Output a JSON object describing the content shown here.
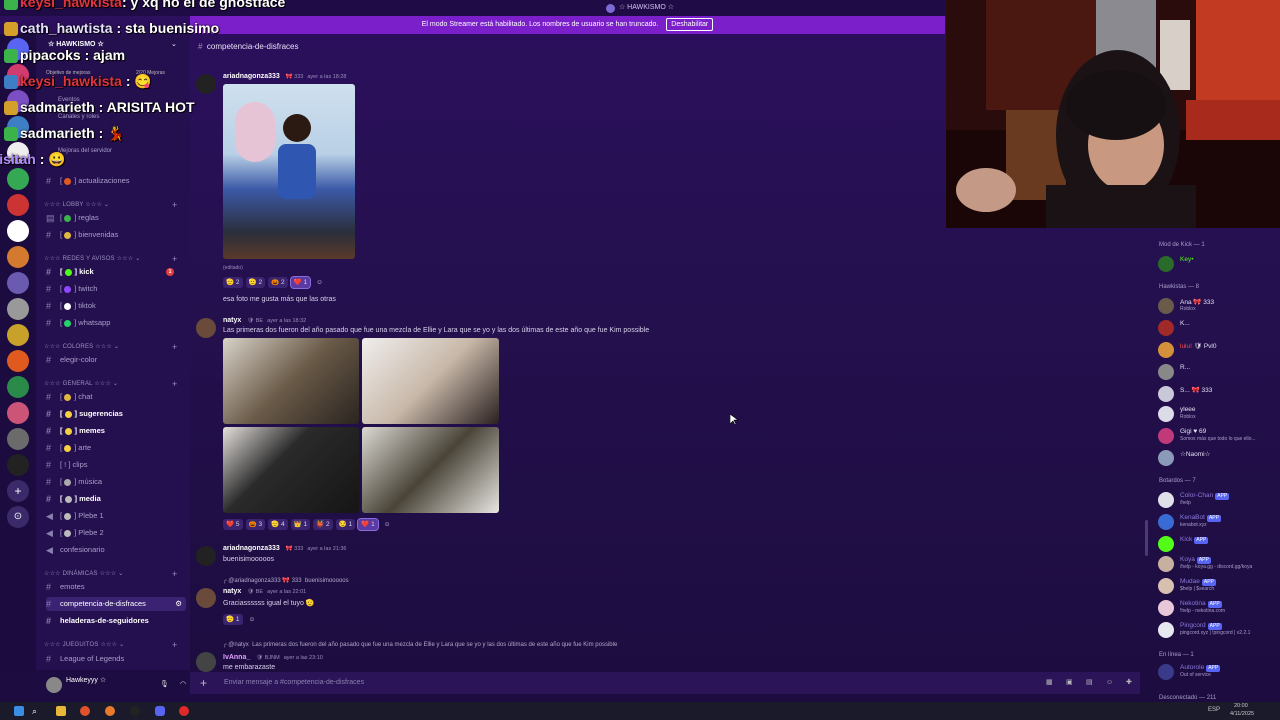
{
  "window": {
    "title": "☆ HAWKISMO ☆"
  },
  "banner": {
    "text": "El modo Streamer está habilitado. Los nombres de usuario se han truncado.",
    "button": "Deshabilitar"
  },
  "server": {
    "name": "☆ HAWKISMO ☆"
  },
  "sidebar": {
    "top_items": [
      "Objetivo de mejoras",
      "Eventos",
      "Canales y roles",
      "Mejoras del servidor"
    ],
    "goal_count": "2/20 Mejoras",
    "categories": {
      "lobby": "☆☆☆ LOBBY ☆☆☆",
      "redes": "☆☆☆ REDES Y AVISOS ☆☆☆",
      "colores": "☆☆☆ COLORES ☆☆☆",
      "general": "☆☆☆ GENERAL ☆☆☆",
      "dinamicas": "☆☆☆ DINÁMICAS ☆☆☆",
      "juegos": "☆☆☆ JUEGUITOS ☆☆☆"
    },
    "channels": {
      "actualizaciones": "actualizaciones",
      "reglas": "reglas",
      "bienvenidas": "bienvenidas",
      "kick": "kick",
      "twitch": "twitch",
      "tiktok": "tiktok",
      "whatsapp": "whatsapp",
      "elegir_color": "elegir-color",
      "chat": "chat",
      "sugerencias": "sugerencias",
      "memes": "memes",
      "arte": "arte",
      "clips": "clips",
      "musica": "música",
      "media": "media",
      "plebe1": "Plebe 1",
      "plebe2": "Plebe 2",
      "confesionario": "confesionario",
      "emotes": "emotes",
      "competencia": "competencia-de-disfraces",
      "heladeras": "heladeras-de-seguidores",
      "league": "League of Legends"
    },
    "kick_badge": "1"
  },
  "userbar": {
    "name": "Hawkeyyy ☆"
  },
  "overlay_chat": [
    {
      "user": "keysi_hawkista",
      "text": ": y xq no el de ghostface"
    },
    {
      "user": "cath_hawtista",
      "text": " : sta buenisimo"
    },
    {
      "user": "pipacoks",
      "text": " : ajam"
    },
    {
      "user": "keysi_hawkista",
      "text": " :"
    },
    {
      "user": "sadmarieth",
      "text": " : ARISITA HOT"
    },
    {
      "user": "sadmarieth",
      "text": " :"
    },
    {
      "user": "arisitah",
      "text": " :"
    }
  ],
  "channel_header": {
    "name": "competencia-de-disfraces"
  },
  "messages": {
    "m1": {
      "user": "ariadnagonza333",
      "tag": "333",
      "time": "ayer a las 18:28",
      "edited": "(editado)",
      "text": "esa foto me gusta más que las otras",
      "reactions": [
        "2",
        "2",
        "2",
        "1"
      ]
    },
    "m2": {
      "user": "natyx",
      "tag": "BE",
      "time": "ayer a las 18:32",
      "text": "Las primeras dos fueron del año pasado que fue una mezcla de Ellie y Lara que se yo y las dos últimas de este año que fue Kim possible",
      "reactions": [
        "5",
        "3",
        "4",
        "1",
        "2",
        "1",
        "1"
      ]
    },
    "m3": {
      "user": "ariadnagonza333",
      "tag": "333",
      "time": "ayer a las 21:36",
      "text": "buenisimooooos"
    },
    "m4": {
      "reply_user": "@ariadnagonza333",
      "reply_tag": "333",
      "reply_text": "buenisimooooos",
      "user": "natyx",
      "tag": "BE",
      "time": "ayer a las 22:01",
      "text": "Graciassssss igual el tuyo",
      "reactions": [
        "1"
      ]
    },
    "m5": {
      "reply_user": "@natyx",
      "reply_text": "Las primeras dos fueron del año pasado que fue una mezcla de Ellie y Lara que se yo y las dos últimas de este año que fue Kim possible",
      "user": "IvAnna_",
      "tag": "BJNM",
      "time": "ayer a las 23:10",
      "text": "me embarazaste"
    }
  },
  "composer": {
    "placeholder": "Enviar mensaje a #competencia-de-disfraces"
  },
  "members": {
    "mods_header": "Mod de Kick — 1",
    "hawkistas_header": "Hawkistas — 8",
    "bots_header": "Botardos — 7",
    "online_header": "En línea — 1",
    "offline_header": "Desconectado — 211",
    "mod": {
      "name": "Key•"
    },
    "hawkistas": [
      {
        "name": "Ana",
        "tag": "333",
        "status": "Roblox"
      },
      {
        "name": "K...",
        "status": ""
      },
      {
        "name": "lulu!",
        "tag": "Pvl0",
        "status": ""
      },
      {
        "name": "R...",
        "status": ""
      },
      {
        "name": "S...",
        "tag": "333",
        "status": ""
      },
      {
        "name": "yleee",
        "status": "Roblox"
      },
      {
        "name": "Gigi",
        "tag": "69",
        "status": "Somos más que todo lo que ello..."
      },
      {
        "name": "☆Naomi☆",
        "status": ""
      }
    ],
    "bots": [
      {
        "name": "Color-Chan",
        "status": "/help"
      },
      {
        "name": "KenaBot",
        "status": "kenabot.xyz"
      },
      {
        "name": "Kick",
        "status": ""
      },
      {
        "name": "Koya",
        "status": "/help - koya.gg - discord.gg/koya"
      },
      {
        "name": "Mudae",
        "status": "$help | $search"
      },
      {
        "name": "Nekotina",
        "status": "!help - nekotina.com"
      },
      {
        "name": "Pingcord",
        "status": "pingcord.xyz | !pingcord | v2.2.1"
      }
    ],
    "online": [
      {
        "name": "Autorole",
        "status": "Out of service"
      }
    ],
    "app_label": "APP"
  },
  "taskbar": {
    "lang": "ESP",
    "time": "20:00",
    "date": "4/11/2025"
  },
  "colors": {
    "accent": "#7a1fc9",
    "bg": "#24104e",
    "sidebar": "#25104f"
  }
}
